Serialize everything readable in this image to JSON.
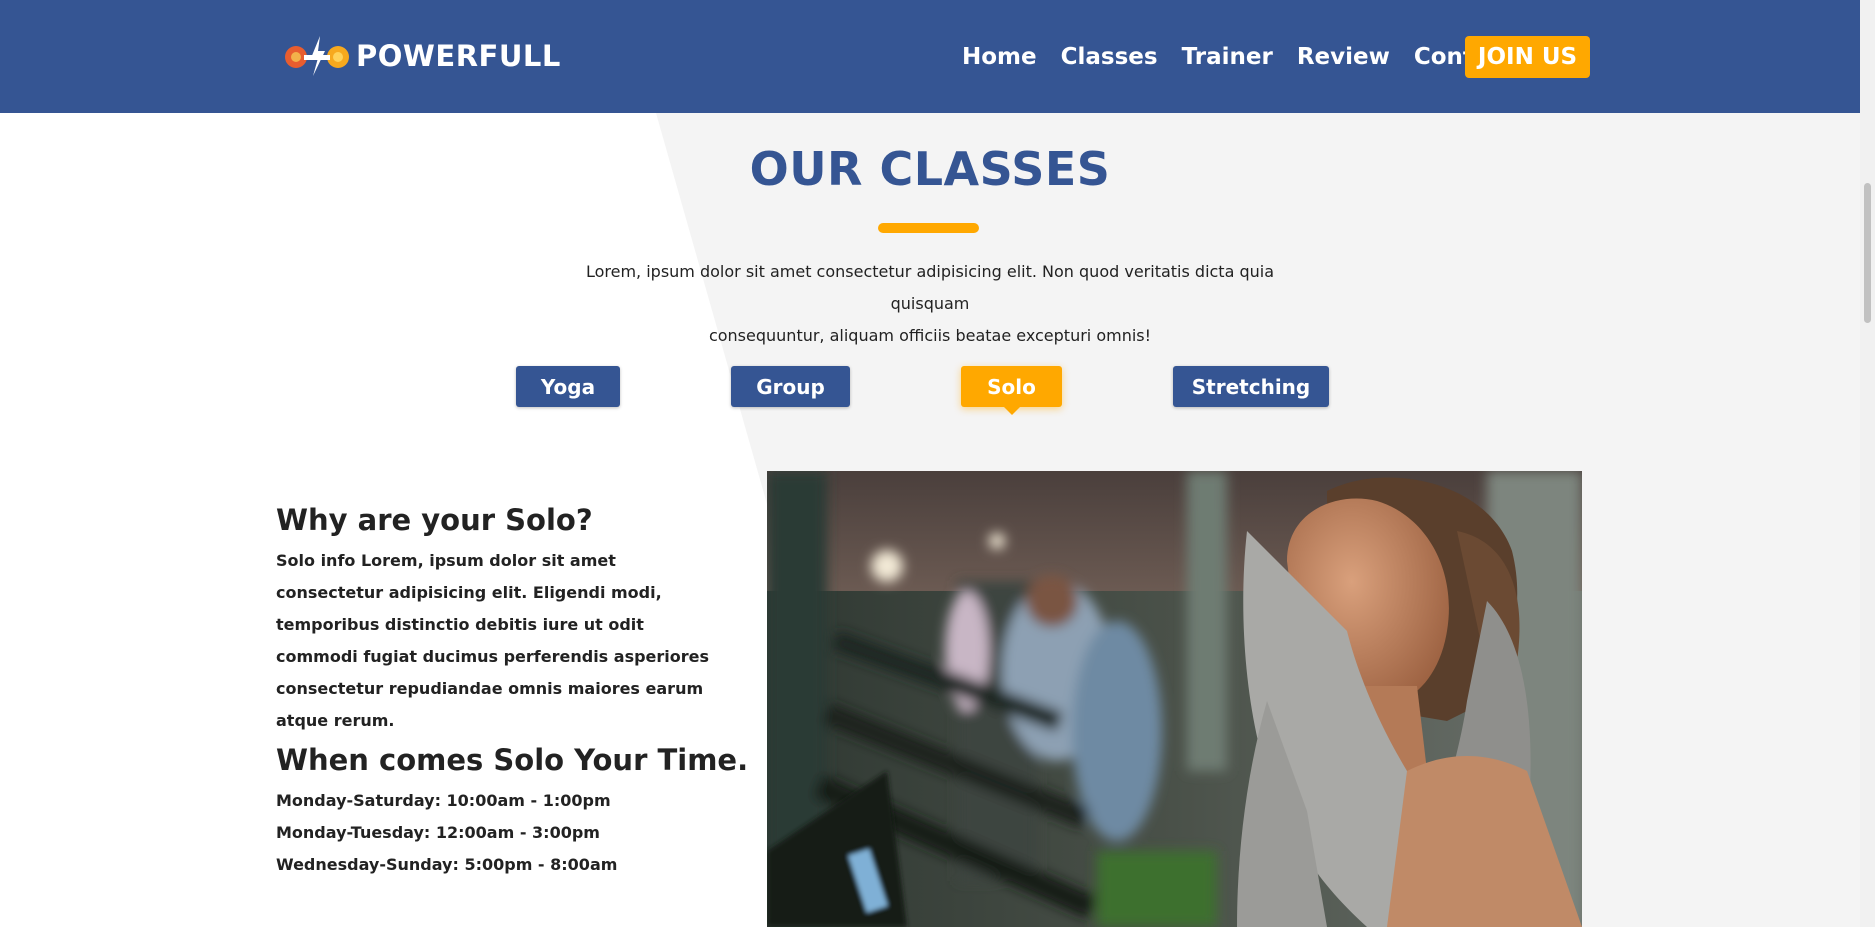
{
  "header": {
    "brand": "POWERFULL",
    "nav": [
      "Home",
      "Classes",
      "Trainer",
      "Review",
      "Contact"
    ],
    "join_label": "JOIN US"
  },
  "classes": {
    "title": "OUR CLASSES",
    "intro_line1": "Lorem, ipsum dolor sit amet consectetur adipisicing elit. Non quod veritatis dicta quia quisquam",
    "intro_line2": "consequuntur, aliquam officiis beatae excepturi omnis!",
    "tabs": [
      {
        "label": "Yoga",
        "active": false
      },
      {
        "label": "Group",
        "active": false
      },
      {
        "label": "Solo",
        "active": true
      },
      {
        "label": "Stretching",
        "active": false
      }
    ],
    "why_heading": "Why are your Solo?",
    "why_text": "Solo info Lorem, ipsum dolor sit amet consectetur adipisicing elit. Eligendi modi, temporibus distinctio debitis iure ut odit commodi fugiat ducimus perferendis asperiores consectetur repudiandae omnis maiores earum atque rerum.",
    "when_heading": "When comes Solo Your Time.",
    "schedule": [
      "Monday-Saturday: 10:00am - 1:00pm",
      "Monday-Tuesday: 12:00am - 3:00pm",
      "Wednesday-Sunday: 5:00pm - 8:00am"
    ]
  },
  "colors": {
    "primary": "#355593",
    "accent": "#ffa800"
  }
}
